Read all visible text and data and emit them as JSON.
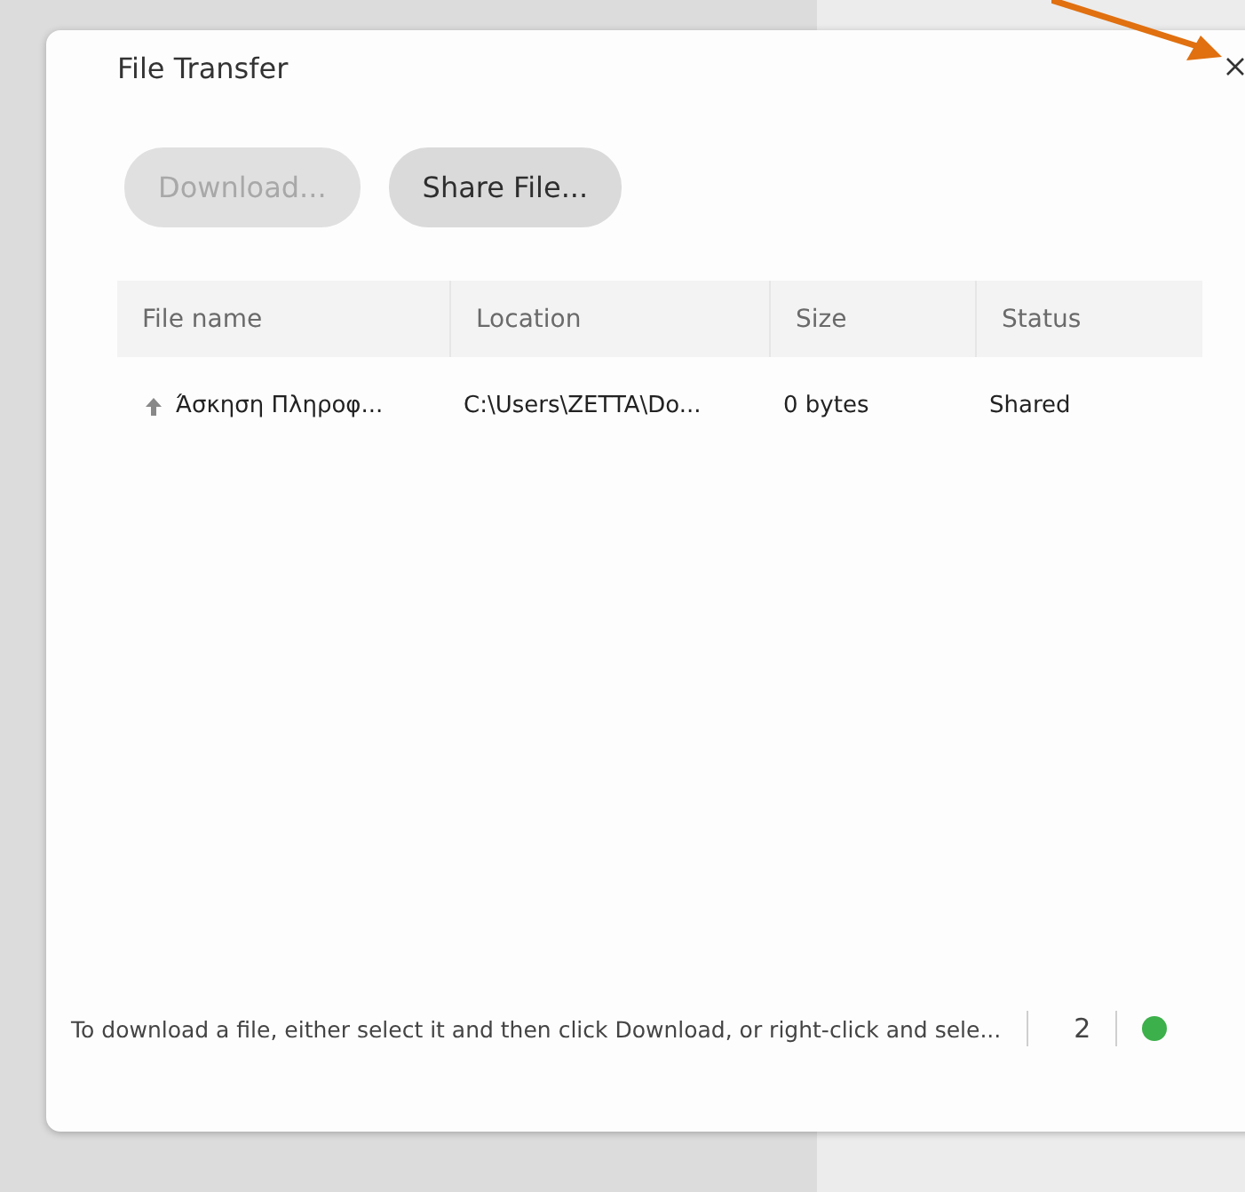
{
  "dialog": {
    "title": "File Transfer"
  },
  "buttons": [
    {
      "label": "Download...",
      "disabled": true
    },
    {
      "label": "Share File...",
      "disabled": false
    }
  ],
  "table": {
    "columns": [
      "File name",
      "Location",
      "Size",
      "Status"
    ],
    "rows": [
      {
        "cells": [
          "Άσκηση Πληροφ...",
          "C:\\Users\\ZETTA\\Do...",
          "0 bytes",
          "Shared"
        ],
        "kind": "upload"
      }
    ]
  },
  "status_bar": {
    "hint": "To download a file, either select it and then click Download, or right-click and sele...",
    "count": "2"
  }
}
